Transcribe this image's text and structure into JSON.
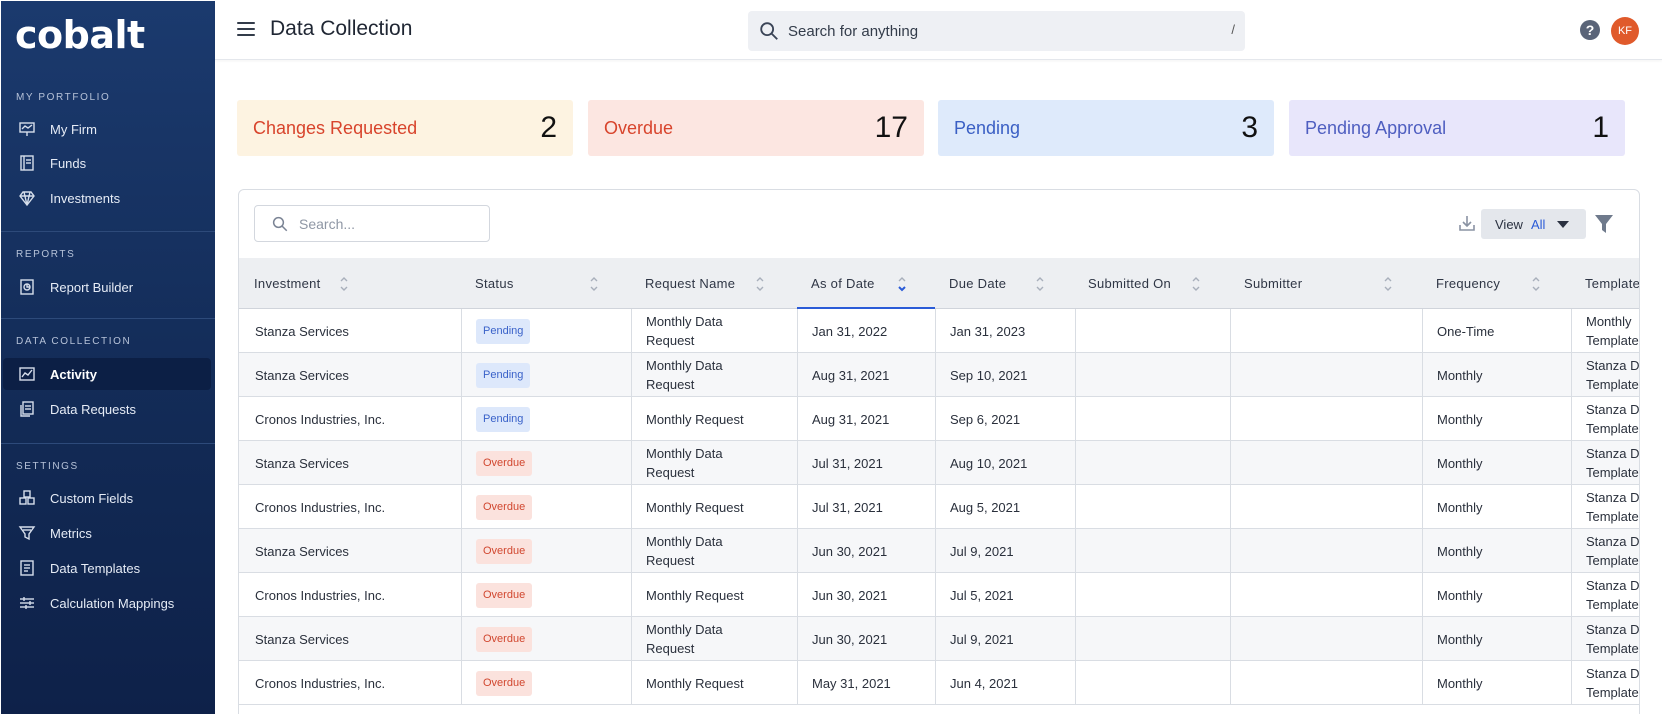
{
  "app": {
    "logo": "cobalt",
    "page_title": "Data Collection"
  },
  "search": {
    "placeholder": "Search for anything",
    "shortcut": "/"
  },
  "user": {
    "initials": "KF"
  },
  "sidebar": {
    "sections": [
      {
        "title": "MY PORTFOLIO",
        "items": [
          {
            "label": "My Firm",
            "icon": "presentation-icon"
          },
          {
            "label": "Funds",
            "icon": "ledger-icon"
          },
          {
            "label": "Investments",
            "icon": "diamond-icon"
          }
        ]
      },
      {
        "title": "REPORTS",
        "items": [
          {
            "label": "Report Builder",
            "icon": "report-icon"
          }
        ]
      },
      {
        "title": "DATA COLLECTION",
        "items": [
          {
            "label": "Activity",
            "icon": "activity-chart-icon",
            "active": true
          },
          {
            "label": "Data Requests",
            "icon": "documents-icon"
          }
        ]
      },
      {
        "title": "SETTINGS",
        "items": [
          {
            "label": "Custom Fields",
            "icon": "blocks-icon"
          },
          {
            "label": "Metrics",
            "icon": "funnel-icon"
          },
          {
            "label": "Data Templates",
            "icon": "template-icon"
          },
          {
            "label": "Calculation Mappings",
            "icon": "sliders-icon"
          }
        ]
      }
    ]
  },
  "stats": [
    {
      "label": "Changes Requested",
      "count": "2",
      "bg": "#fdf3e1",
      "color": "#d8442c"
    },
    {
      "label": "Overdue",
      "count": "17",
      "bg": "#fce6e1",
      "color": "#d8442c"
    },
    {
      "label": "Pending",
      "count": "3",
      "bg": "#deeafb",
      "color": "#3a5fc4"
    },
    {
      "label": "Pending Approval",
      "count": "1",
      "bg": "#e8e6fb",
      "color": "#4e5ec0"
    }
  ],
  "table": {
    "search_placeholder": "Search...",
    "view_label": "View",
    "view_value": "All",
    "columns": [
      "Investment",
      "Status",
      "Request Name",
      "As of Date",
      "Due Date",
      "Submitted On",
      "Submitter",
      "Frequency",
      "Template"
    ],
    "rows": [
      {
        "investment": "Stanza Services",
        "status": "Pending",
        "request": [
          "Monthly Data",
          "Request"
        ],
        "as_of": "Jan 31, 2022",
        "due": "Jan 31, 2023",
        "submitted": "",
        "submitter": "",
        "frequency": "One-Time",
        "template": [
          "Monthly",
          "Template"
        ]
      },
      {
        "investment": "Stanza Services",
        "status": "Pending",
        "request": [
          "Monthly Data",
          "Request"
        ],
        "as_of": "Aug 31, 2021",
        "due": "Sep 10, 2021",
        "submitted": "",
        "submitter": "",
        "frequency": "Monthly",
        "template": [
          "Stanza D",
          "Template"
        ]
      },
      {
        "investment": "Cronos Industries, Inc.",
        "status": "Pending",
        "request": [
          "Monthly Request"
        ],
        "as_of": "Aug 31, 2021",
        "due": "Sep 6, 2021",
        "submitted": "",
        "submitter": "",
        "frequency": "Monthly",
        "template": [
          "Stanza D",
          "Template"
        ]
      },
      {
        "investment": "Stanza Services",
        "status": "Overdue",
        "request": [
          "Monthly Data",
          "Request"
        ],
        "as_of": "Jul 31, 2021",
        "due": "Aug 10, 2021",
        "submitted": "",
        "submitter": "",
        "frequency": "Monthly",
        "template": [
          "Stanza D",
          "Template"
        ]
      },
      {
        "investment": "Cronos Industries, Inc.",
        "status": "Overdue",
        "request": [
          "Monthly Request"
        ],
        "as_of": "Jul 31, 2021",
        "due": "Aug 5, 2021",
        "submitted": "",
        "submitter": "",
        "frequency": "Monthly",
        "template": [
          "Stanza D",
          "Template"
        ]
      },
      {
        "investment": "Stanza Services",
        "status": "Overdue",
        "request": [
          "Monthly Data",
          "Request"
        ],
        "as_of": "Jun 30, 2021",
        "due": "Jul 9, 2021",
        "submitted": "",
        "submitter": "",
        "frequency": "Monthly",
        "template": [
          "Stanza D",
          "Template"
        ]
      },
      {
        "investment": "Cronos Industries, Inc.",
        "status": "Overdue",
        "request": [
          "Monthly Request"
        ],
        "as_of": "Jun 30, 2021",
        "due": "Jul 5, 2021",
        "submitted": "",
        "submitter": "",
        "frequency": "Monthly",
        "template": [
          "Stanza D",
          "Template"
        ]
      },
      {
        "investment": "Stanza Services",
        "status": "Overdue",
        "request": [
          "Monthly Data",
          "Request"
        ],
        "as_of": "Jun 30, 2021",
        "due": "Jul 9, 2021",
        "submitted": "",
        "submitter": "",
        "frequency": "Monthly",
        "template": [
          "Stanza D",
          "Template"
        ]
      },
      {
        "investment": "Cronos Industries, Inc.",
        "status": "Overdue",
        "request": [
          "Monthly Request"
        ],
        "as_of": "May 31, 2021",
        "due": "Jun 4, 2021",
        "submitted": "",
        "submitter": "",
        "frequency": "Monthly",
        "template": [
          "Stanza D",
          "Template"
        ]
      }
    ]
  }
}
